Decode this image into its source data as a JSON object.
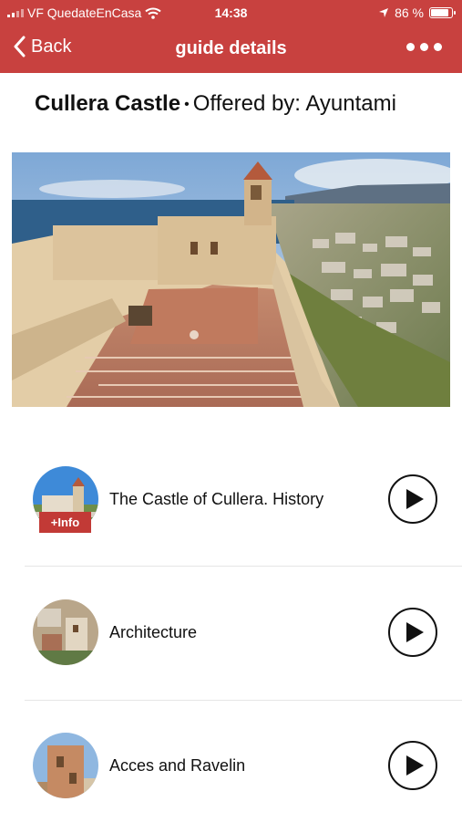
{
  "status_bar": {
    "carrier": "VF QuedateEnCasa",
    "time": "14:38",
    "battery": "86 %"
  },
  "nav": {
    "back_label": "Back",
    "title": "guide details"
  },
  "guide": {
    "name": "Cullera Castle",
    "separator": "•",
    "offered_by_label": "Offered by:",
    "offered_by_value": "Ayuntami"
  },
  "items": [
    {
      "title": "The Castle of Cullera. History",
      "badge": "+Info"
    },
    {
      "title": "Architecture"
    },
    {
      "title": "Acces and Ravelin"
    }
  ],
  "colors": {
    "header": "#c8413f",
    "badge": "#c23a36"
  }
}
